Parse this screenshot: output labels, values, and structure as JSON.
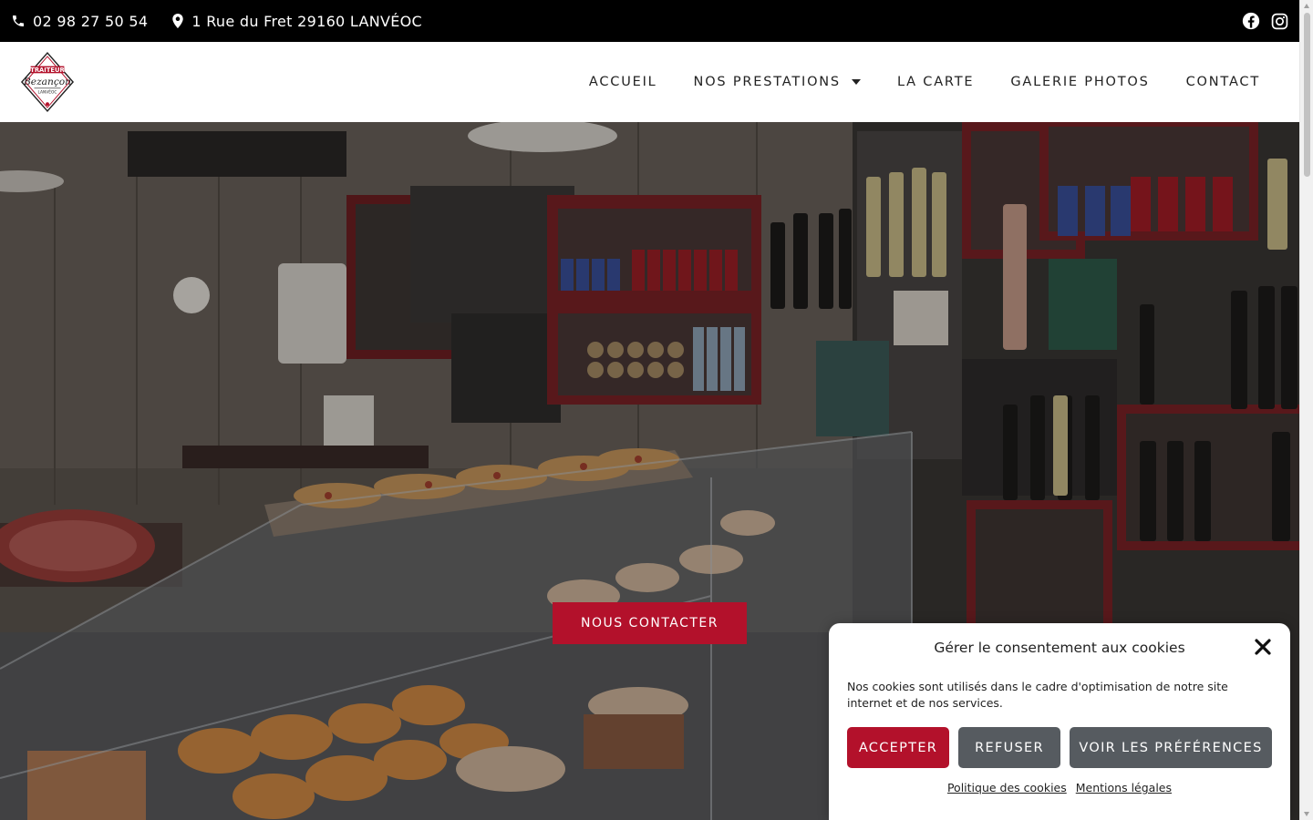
{
  "topbar": {
    "phone": "02 98 27 50 54",
    "address": "1 Rue du Fret 29160 LANVÉOC",
    "phone_icon": "phone-icon",
    "location_icon": "map-pin-icon",
    "social": [
      "facebook-icon",
      "instagram-icon"
    ]
  },
  "logo": {
    "line1": "TRAITEUR",
    "line2": "Bezançon",
    "line3": "LANVÉOC"
  },
  "nav": {
    "items": [
      {
        "label": "ACCUEIL"
      },
      {
        "label": "NOS PRESTATIONS"
      },
      {
        "label": "LA CARTE"
      },
      {
        "label": "GALERIE PHOTOS"
      },
      {
        "label": "CONTACT"
      }
    ]
  },
  "hero": {
    "cta_label": "NOUS CONTACTER"
  },
  "cookie": {
    "title": "Gérer le consentement aux cookies",
    "message": "Nos cookies sont utilisés dans le cadre d'optimisation de notre site internet et de nos services.",
    "accept": "ACCEPTER",
    "refuse": "REFUSER",
    "preferences": "VOIR LES PRÉFÉRENCES",
    "link_policy": "Politique des cookies",
    "link_legal": "Mentions légales"
  },
  "colors": {
    "brand_red": "#b3112b",
    "topbar_bg": "#000000",
    "secondary_btn": "#565b60"
  }
}
